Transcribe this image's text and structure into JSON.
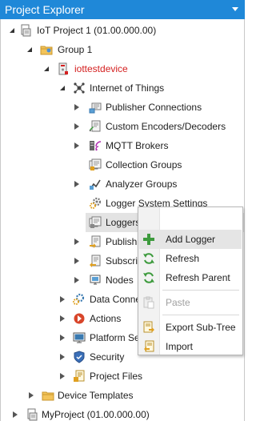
{
  "panel": {
    "title": "Project Explorer"
  },
  "tree": {
    "project": "IoT Project 1 (01.00.000.00)",
    "group": "Group 1",
    "device": "iottestdevice",
    "iot": "Internet of Things",
    "publisher_connections": "Publisher Connections",
    "custom_encoders": "Custom Encoders/Decoders",
    "mqtt_brokers": "MQTT Brokers",
    "collection_groups": "Collection Groups",
    "analyzer_groups": "Analyzer Groups",
    "logger_system_settings": "Logger System Settings",
    "loggers": "Loggers",
    "publish": "Publish",
    "subscriptions": "Subscrib",
    "nodes": "Nodes",
    "data_connections": "Data Conne",
    "actions": "Actions",
    "platform": "Platform Se",
    "security": "Security",
    "project_files": "Project Files",
    "device_templates": "Device Templates",
    "my_project": "MyProject (01.00.000.00)"
  },
  "context_menu": {
    "add_logger": "Add Logger",
    "refresh": "Refresh",
    "refresh_parent": "Refresh Parent",
    "paste": "Paste",
    "export_subtree": "Export Sub-Tree",
    "import": "Import"
  },
  "colors": {
    "title_bar": "#1f88d8",
    "device_label": "#d42020",
    "selection": "#e3e3e3"
  }
}
